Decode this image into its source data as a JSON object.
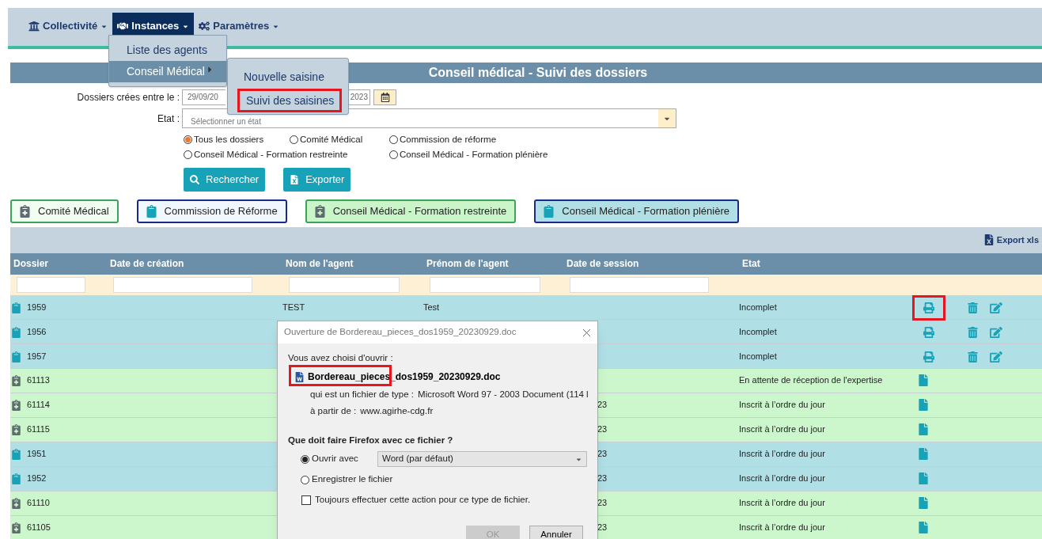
{
  "nav": {
    "items": [
      {
        "label": "Collectivité",
        "selected": false
      },
      {
        "label": "Instances",
        "selected": true
      },
      {
        "label": "Paramètres",
        "selected": false
      }
    ]
  },
  "menu": {
    "items": [
      {
        "label": "Liste des agents",
        "selected": false,
        "has_submenu": false
      },
      {
        "label": "Conseil Médical",
        "selected": true,
        "has_submenu": true
      }
    ]
  },
  "submenu": {
    "items": [
      {
        "label": "Nouvelle saisine",
        "highlighted": false
      },
      {
        "label": "Suivi des saisines",
        "highlighted": true
      }
    ]
  },
  "page_title": "Conseil médical - Suivi des dossiers",
  "form": {
    "date_label": "Dossiers crées entre le :",
    "date_start": "29/09/20",
    "date_end": "2023",
    "etat_label": "Etat :",
    "etat_placeholder": "Sélectionner un état",
    "radios": [
      {
        "label": "Tous les dossiers",
        "selected": true
      },
      {
        "label": "Comité Médical",
        "selected": false
      },
      {
        "label": "Commission de réforme",
        "selected": false
      },
      {
        "label": "Conseil Médical - Formation restreinte",
        "selected": false
      },
      {
        "label": "Conseil Médical - Formation plénière",
        "selected": false
      }
    ],
    "buttons": [
      {
        "label": "Rechercher",
        "kind": "search"
      },
      {
        "label": "Exporter",
        "kind": "excel"
      }
    ]
  },
  "categories": [
    {
      "label": "Comité Médical",
      "kind": "comite",
      "selected": false
    },
    {
      "label": "Commission de Réforme",
      "kind": "reforme",
      "selected": false
    },
    {
      "label": "Conseil Médical - Formation restreinte",
      "kind": "comite",
      "selected": true
    },
    {
      "label": "Conseil Médical - Formation plénière",
      "kind": "reforme",
      "selected": true
    }
  ],
  "export_label": "Export xls",
  "table": {
    "columns": [
      "Dossier",
      "Date de création",
      "Nom de l'agent",
      "Prénom de l'agent",
      "Date de session",
      "Etat"
    ],
    "rows": [
      {
        "dossier": "1959",
        "nom": "TEST",
        "prenom": "Test",
        "date_session": "",
        "etat": "Incomplet",
        "kind": "reforme",
        "editable": true,
        "highlighted": true
      },
      {
        "dossier": "1956",
        "nom": "",
        "prenom": "",
        "date_session": "",
        "etat": "Incomplet",
        "kind": "reforme",
        "editable": true,
        "highlighted": false
      },
      {
        "dossier": "1957",
        "nom": "",
        "prenom": "",
        "date_session": "",
        "etat": "Incomplet",
        "kind": "reforme",
        "editable": true,
        "highlighted": false
      },
      {
        "dossier": "61113",
        "nom": "",
        "prenom": "",
        "date_session": "",
        "etat": "En attente de réception de l'expertise",
        "kind": "comite",
        "editable": false,
        "highlighted": false
      },
      {
        "dossier": "61114",
        "nom": "",
        "prenom": "",
        "date_session": "23",
        "etat": "Inscrit à l’ordre du jour",
        "kind": "comite",
        "editable": false,
        "highlighted": false
      },
      {
        "dossier": "61115",
        "nom": "",
        "prenom": "",
        "date_session": "23",
        "etat": "Inscrit à l’ordre du jour",
        "kind": "comite",
        "editable": false,
        "highlighted": false
      },
      {
        "dossier": "1951",
        "nom": "",
        "prenom": "",
        "date_session": "23",
        "etat": "Inscrit à l’ordre du jour",
        "kind": "reforme",
        "editable": false,
        "highlighted": false
      },
      {
        "dossier": "1952",
        "nom": "",
        "prenom": "",
        "date_session": "23",
        "etat": "Inscrit à l’ordre du jour",
        "kind": "reforme",
        "editable": false,
        "highlighted": false
      },
      {
        "dossier": "61110",
        "nom": "",
        "prenom": "",
        "date_session": "23",
        "etat": "Inscrit à l’ordre du jour",
        "kind": "comite",
        "editable": false,
        "highlighted": false
      },
      {
        "dossier": "61105",
        "nom": "",
        "prenom": "",
        "date_session": "23",
        "etat": "Inscrit à l’ordre du jour",
        "kind": "comite",
        "editable": false,
        "highlighted": false
      }
    ]
  },
  "dialog": {
    "title": "Ouverture de Bordereau_pieces_dos1959_20230929.doc",
    "intro": "Vous avez choisi d'ouvrir :",
    "filename": "Bordereau_pieces_dos1959_20230929.doc",
    "file_highlighted": true,
    "type_label": "qui est un fichier de type :",
    "type_value": "Microsoft Word 97 - 2003 Document (114 l",
    "from_label": "à partir de :",
    "from_value": "www.agirhe-cdg.fr",
    "question": "Que doit faire Firefox avec ce fichier ?",
    "options": [
      {
        "label": "Ouvrir avec",
        "selected": true
      },
      {
        "label": "Enregistrer le fichier",
        "selected": false
      }
    ],
    "app_select": "Word (par défaut)",
    "always_label": "Toujours effectuer cette action pour ce type de fichier.",
    "always_checked": false,
    "buttons": [
      {
        "label": "OK",
        "disabled": true
      },
      {
        "label": "Annuler",
        "disabled": false
      }
    ]
  }
}
